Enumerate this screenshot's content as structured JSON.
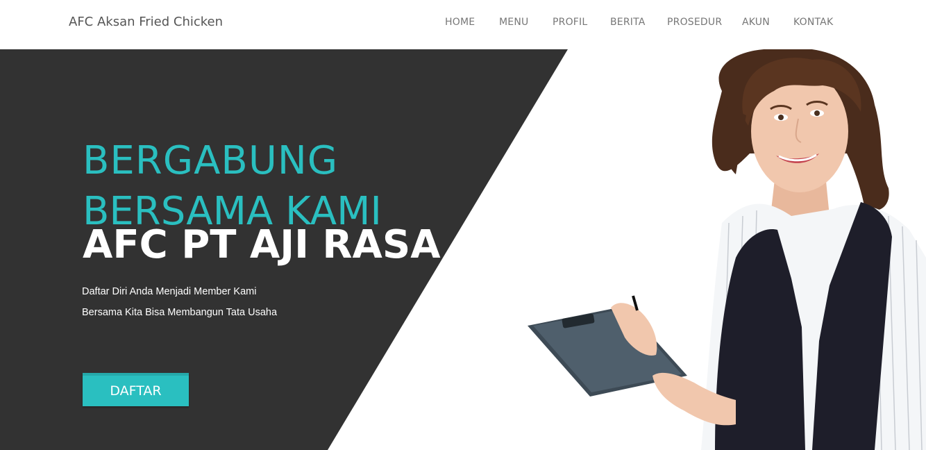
{
  "navbar": {
    "brand": "AFC Aksan Fried Chicken",
    "items": [
      {
        "label": "HOME"
      },
      {
        "label": "MENU"
      },
      {
        "label": "PROFIL"
      },
      {
        "label": "BERITA"
      },
      {
        "label": "PROSEDUR"
      },
      {
        "label": "AKUN"
      },
      {
        "label": "KONTAK"
      }
    ]
  },
  "hero": {
    "title_line1": "BERGABUNG",
    "title_line2": "BERSAMA KAMI",
    "title_line3": "AFC PT AJI RASA",
    "desc_line1": "Daftar Diri Anda Menjadi Member Kami",
    "desc_line2": "Bersama Kita Bisa Membangun Tata Usaha",
    "cta_label": "DAFTAR"
  },
  "colors": {
    "accent": "#2ABFC0",
    "dark_panel": "#323232",
    "nav_text": "#777777",
    "brand_text": "#555555"
  },
  "icons": {
    "hero_image": "woman-with-clipboard-photo"
  }
}
